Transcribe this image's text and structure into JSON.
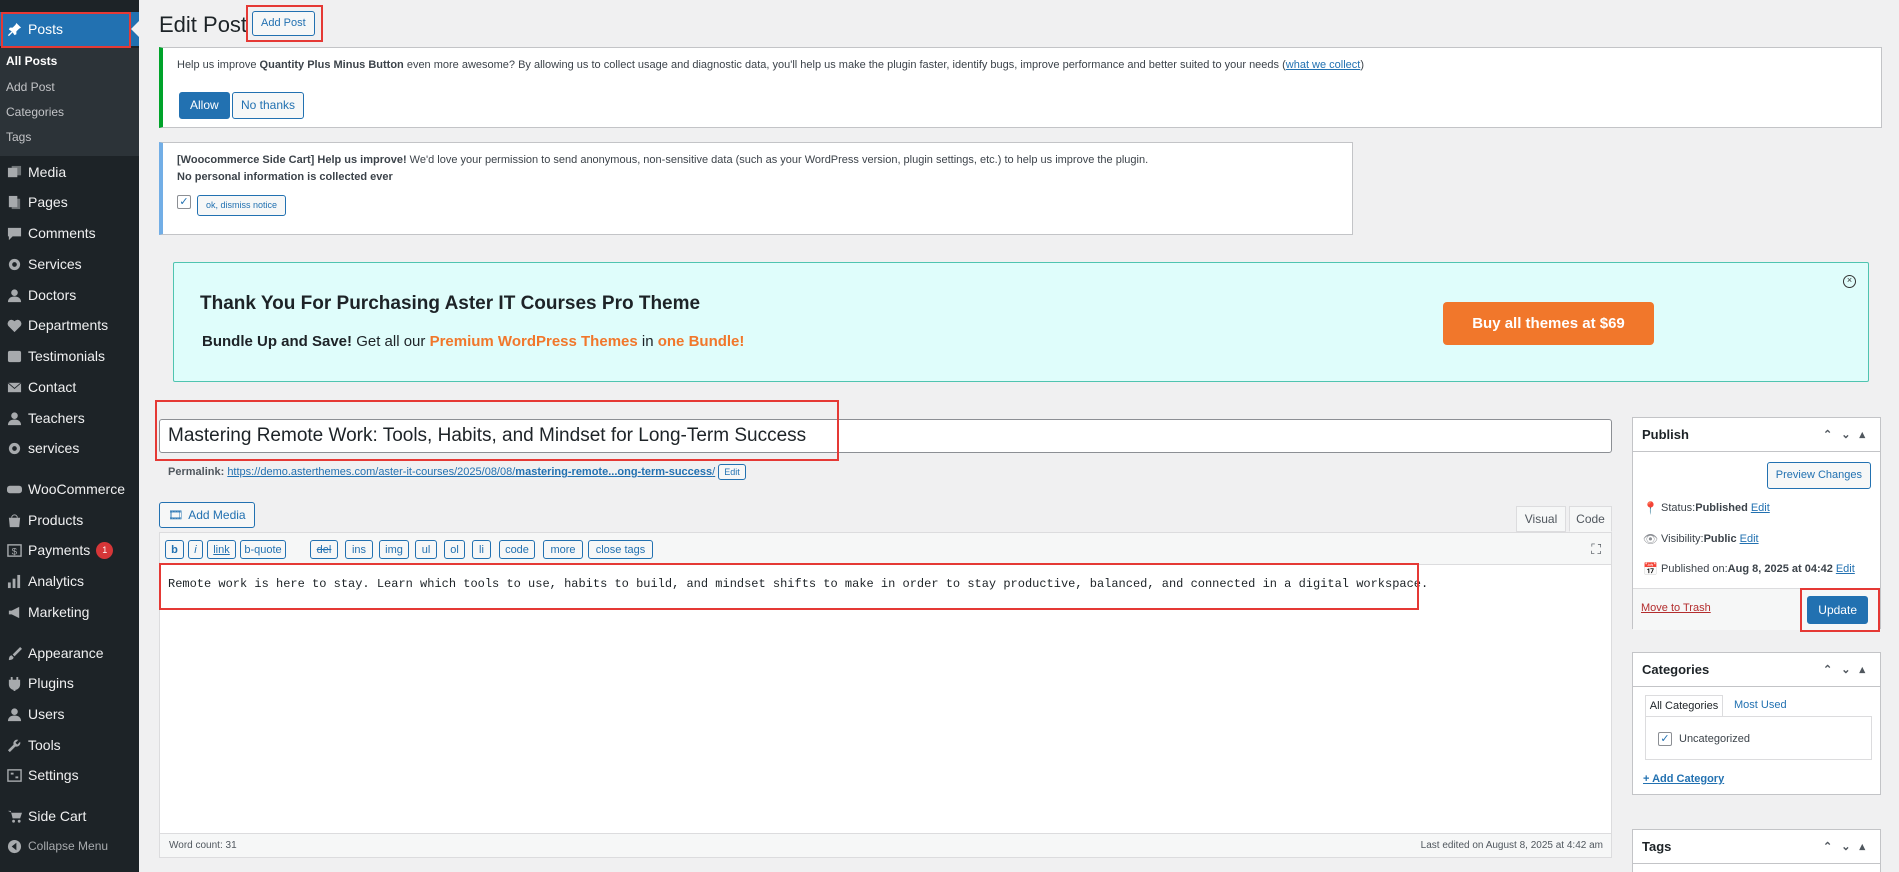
{
  "sidebar": {
    "posts_label": "Posts",
    "submenu": [
      "All Posts",
      "Add Post",
      "Categories",
      "Tags"
    ],
    "items": [
      {
        "label": "Media",
        "icon": "media-icon"
      },
      {
        "label": "Pages",
        "icon": "pages-icon"
      },
      {
        "label": "Comments",
        "icon": "comments-icon"
      },
      {
        "label": "Services",
        "icon": "gear-icon"
      },
      {
        "label": "Doctors",
        "icon": "user-icon"
      },
      {
        "label": "Departments",
        "icon": "heart-icon"
      },
      {
        "label": "Testimonials",
        "icon": "testimonial-icon"
      },
      {
        "label": "Contact",
        "icon": "mail-icon"
      },
      {
        "label": "Teachers",
        "icon": "user-icon"
      },
      {
        "label": "services",
        "icon": "gear-icon"
      },
      {
        "label": "WooCommerce",
        "icon": "woo-icon"
      },
      {
        "label": "Products",
        "icon": "products-icon"
      },
      {
        "label": "Payments",
        "icon": "payments-icon",
        "badge": "1"
      },
      {
        "label": "Analytics",
        "icon": "analytics-icon"
      },
      {
        "label": "Marketing",
        "icon": "megaphone-icon"
      },
      {
        "label": "Appearance",
        "icon": "brush-icon"
      },
      {
        "label": "Plugins",
        "icon": "plug-icon"
      },
      {
        "label": "Users",
        "icon": "user-icon"
      },
      {
        "label": "Tools",
        "icon": "wrench-icon"
      },
      {
        "label": "Settings",
        "icon": "settings-icon"
      },
      {
        "label": "Side Cart",
        "icon": "cart-icon"
      }
    ],
    "collapse_label": "Collapse Menu"
  },
  "header": {
    "title": "Edit Post",
    "add_post_label": "Add Post"
  },
  "notice1": {
    "text_a": "Help us improve ",
    "plugin": "Quantity Plus Minus Button",
    "text_b": " even more awesome? By allowing us to collect usage and diagnostic data, you'll help us make the plugin faster, identify bugs, improve performance and better suited to your needs (",
    "link": "what we collect",
    "text_c": ")",
    "allow": "Allow",
    "no_thanks": "No thanks"
  },
  "notice2": {
    "bold": "[Woocommerce Side Cart] Help us improve!",
    "text": " We'd love your permission to send anonymous, non-sensitive data (such as your WordPress version, plugin settings, etc.) to help us improve the plugin.",
    "line2": "No personal information is collected ever",
    "dismiss": "ok, dismiss notice"
  },
  "promo": {
    "heading": "Thank You For Purchasing Aster IT Courses Pro Theme",
    "bundle_bold": "Bundle Up and Save!",
    "get_all": " Get all our ",
    "premium": "Premium WordPress Themes",
    "in": " in ",
    "one_bundle": "one Bundle!",
    "buy": "Buy all themes at $69"
  },
  "post": {
    "title": "Mastering Remote Work: Tools, Habits, and Mindset for Long-Term Success",
    "permalink_label": "Permalink:",
    "permalink_base": "https://demo.asterthemes.com/aster-it-courses/2025/08/08/",
    "permalink_slug": "mastering-remote...ong-term-success",
    "permalink_tail": "/",
    "edit": "Edit",
    "add_media": "Add Media",
    "tab_visual": "Visual",
    "tab_code": "Code",
    "quicktags": [
      "b",
      "i",
      "link",
      "b-quote",
      "del",
      "ins",
      "img",
      "ul",
      "ol",
      "li",
      "code",
      "more",
      "close tags"
    ],
    "content": "Remote work is here to stay. Learn which tools to use, habits to build, and mindset shifts to make in order to stay productive, balanced, and connected in a digital workspace.",
    "word_count": "Word count: 31",
    "last_edited": "Last edited on August 8, 2025 at 4:42 am"
  },
  "publish": {
    "title": "Publish",
    "preview": "Preview Changes",
    "status_label": "Status: ",
    "status": "Published",
    "visibility_label": "Visibility: ",
    "visibility": "Public",
    "published_label": "Published on: ",
    "published": "Aug 8, 2025 at 04:42",
    "edit": "Edit",
    "trash": "Move to Trash",
    "update": "Update"
  },
  "categories": {
    "title": "Categories",
    "tab_all": "All Categories",
    "tab_used": "Most Used",
    "item": "Uncategorized",
    "add": "+ Add Category"
  },
  "tags": {
    "title": "Tags"
  },
  "colors": {
    "accent": "#2271b1",
    "sidebar": "#1d2327",
    "promo_orange": "#f1772b",
    "highlight": "#e53935"
  }
}
